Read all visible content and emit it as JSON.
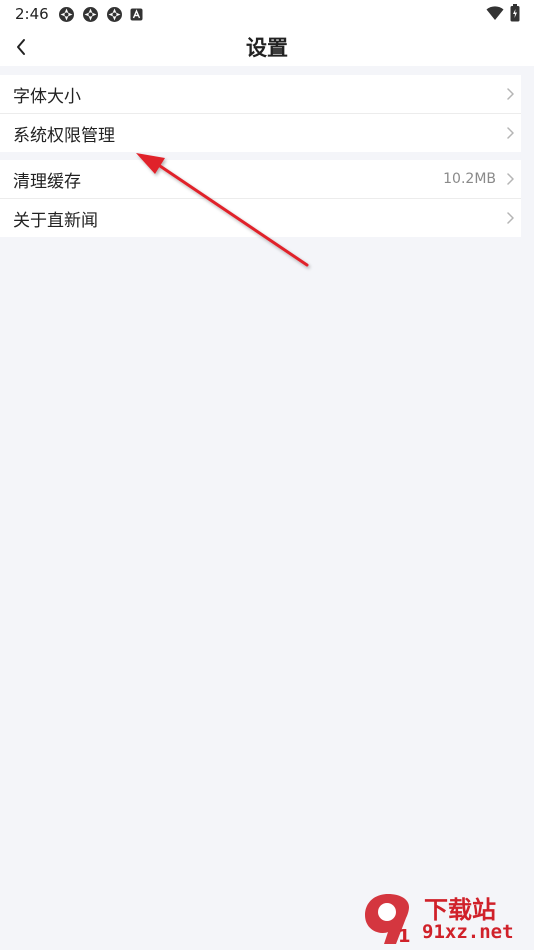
{
  "status_bar": {
    "time": "2:46",
    "left_icons": [
      "notification-icon",
      "notification-icon",
      "notification-icon",
      "app-icon"
    ],
    "right_icons": [
      "wifi-icon",
      "battery-icon"
    ]
  },
  "header": {
    "title": "设置",
    "back_icon": "chevron-left-icon"
  },
  "settings_groups": [
    {
      "items": [
        {
          "label": "字体大小",
          "value": ""
        },
        {
          "label": "系统权限管理",
          "value": ""
        }
      ]
    },
    {
      "items": [
        {
          "label": "清理缓存",
          "value": "10.2MB"
        },
        {
          "label": "关于直新闻",
          "value": ""
        }
      ]
    }
  ],
  "annotation": {
    "arrow_color": "#e0242b",
    "target": "系统权限管理"
  },
  "watermark": {
    "logo_text": "91",
    "title": "下载站",
    "site": "91xz.net",
    "color": "#d0212a"
  }
}
